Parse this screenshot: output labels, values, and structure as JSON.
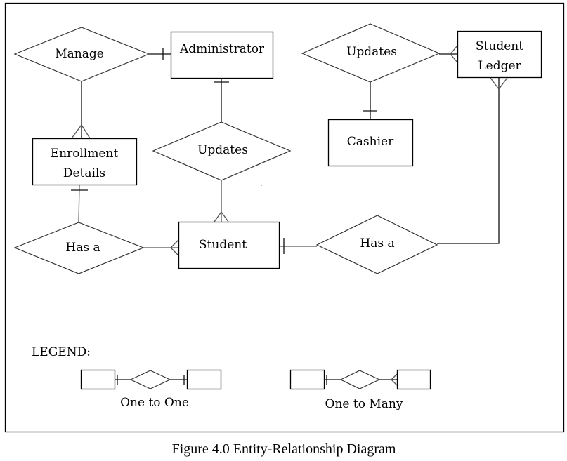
{
  "caption": "Figure 4.0 Entity-Relationship Diagram",
  "entities": {
    "administrator": "Administrator",
    "enrollment_details": [
      "Enrollment",
      "Details"
    ],
    "student": "Student",
    "student_ledger": [
      "Student",
      "Ledger"
    ],
    "cashier": "Cashier"
  },
  "relationships": {
    "manage": "Manage",
    "updates_admin_student": "Updates",
    "has_a_enrollment_student": "Has a",
    "has_a_student_ledger": "Has a",
    "updates_cashier_ledger": "Updates"
  },
  "connections": [
    {
      "from": "Manage",
      "to": "Administrator",
      "cardinality": "one"
    },
    {
      "from": "Manage",
      "to": "Enrollment Details",
      "cardinality": "many"
    },
    {
      "from": "Updates",
      "to": "Administrator",
      "cardinality": "one"
    },
    {
      "from": "Updates",
      "to": "Student",
      "cardinality": "many"
    },
    {
      "from": "Has a",
      "to": "Enrollment Details",
      "cardinality": "one"
    },
    {
      "from": "Has a",
      "to": "Student",
      "cardinality": "many"
    },
    {
      "from": "Has a",
      "to": "Student",
      "cardinality": "one"
    },
    {
      "from": "Has a",
      "to": "Student Ledger",
      "cardinality": "many"
    },
    {
      "from": "Updates",
      "to": "Cashier",
      "cardinality": "one"
    },
    {
      "from": "Updates",
      "to": "Student Ledger",
      "cardinality": "many"
    }
  ],
  "legend": {
    "title": "LEGEND:",
    "items": [
      {
        "label": "One to One"
      },
      {
        "label": "One to Many"
      }
    ]
  }
}
